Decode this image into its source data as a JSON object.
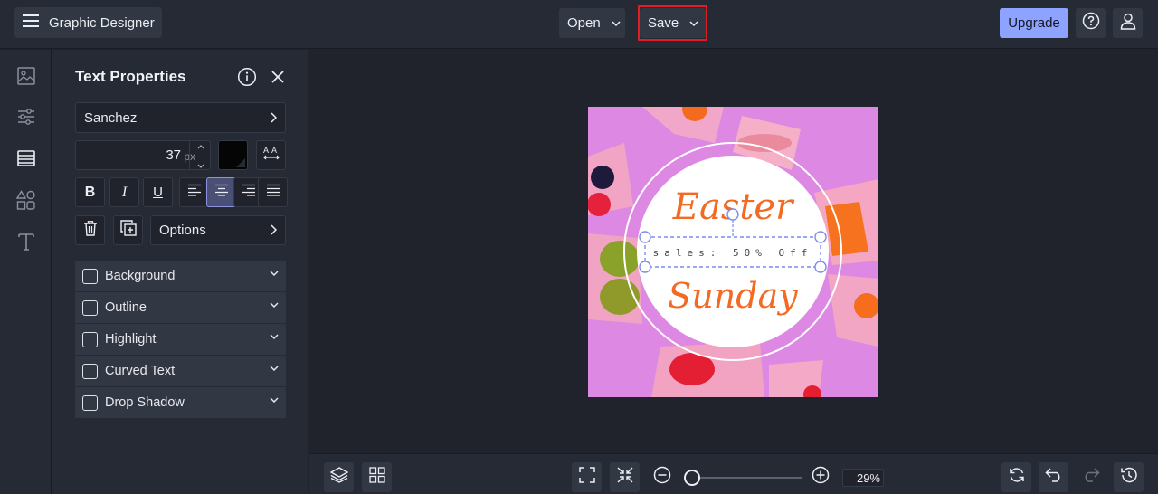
{
  "header": {
    "app_title": "Graphic Designer",
    "open_label": "Open",
    "save_label": "Save",
    "upgrade_label": "Upgrade",
    "accent_color": "#8ea2ff",
    "highlight_color": "#e11d24"
  },
  "rail": {
    "items": [
      {
        "name": "images-icon"
      },
      {
        "name": "adjustments-icon"
      },
      {
        "name": "background-icon",
        "active": true
      },
      {
        "name": "shapes-icon"
      },
      {
        "name": "text-icon"
      }
    ]
  },
  "panel": {
    "title": "Text Properties",
    "font_name": "Sanchez",
    "font_size": "37",
    "font_size_unit": "px",
    "text_color": "#000000",
    "alignment": "center",
    "options_label": "Options",
    "sections": [
      {
        "label": "Background",
        "checked": false
      },
      {
        "label": "Outline",
        "checked": false
      },
      {
        "label": "Highlight",
        "checked": false
      },
      {
        "label": "Curved Text",
        "checked": false
      },
      {
        "label": "Drop Shadow",
        "checked": false
      }
    ]
  },
  "canvas": {
    "headline": "Easter",
    "subline": "sales: 50% Off",
    "footer_word": "Sunday",
    "background_color": "#dd88e3",
    "script_color": "#f26a23"
  },
  "bottom_bar": {
    "zoom": "29%",
    "zoom_fraction": 0.0
  }
}
